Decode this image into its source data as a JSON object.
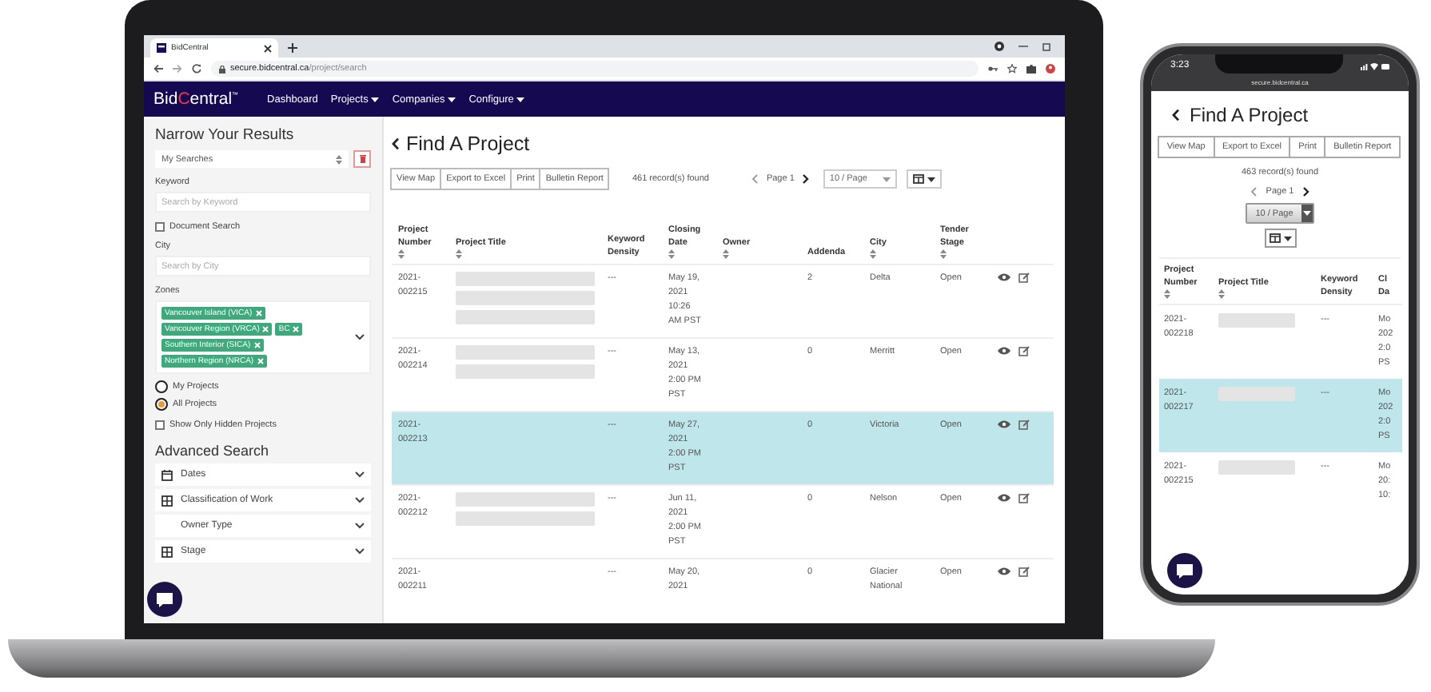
{
  "laptop": {
    "browser": {
      "tab": {
        "title": "BidCentral"
      },
      "url": {
        "host": "secure.bidcentral.ca",
        "path": "/project/search"
      }
    },
    "navbar": {
      "logo": [
        {
          "text": "Bid",
          "accent": false
        },
        {
          "text": "C",
          "accent": true
        },
        {
          "text": "entral",
          "accent": false
        }
      ],
      "trademark": "™",
      "items": [
        {
          "label": "Dashboard",
          "dropdown": false
        },
        {
          "label": "Projects",
          "dropdown": true
        },
        {
          "label": "Companies",
          "dropdown": true
        },
        {
          "label": "Configure",
          "dropdown": true
        }
      ]
    },
    "sidebar": {
      "title": "Narrow Your Results",
      "saved_searches": {
        "value": "My Searches"
      },
      "keyword": {
        "label": "Keyword",
        "placeholder": "Search by Keyword"
      },
      "document_search": {
        "label": "Document Search",
        "checked": false
      },
      "city": {
        "label": "City",
        "placeholder": "Search by City"
      },
      "zones": {
        "label": "Zones",
        "tags": [
          "Vancouver Island (VICA)",
          "Vancouver Region (VRCA)",
          "BC",
          "Southern Interior (SICA)",
          "Northern Region (NRCA)"
        ]
      },
      "scope": [
        {
          "label": "My Projects",
          "selected": false
        },
        {
          "label": "All Projects",
          "selected": true
        }
      ],
      "hidden_only": {
        "label": "Show Only Hidden Projects",
        "checked": false
      },
      "advanced_title": "Advanced Search",
      "advanced": [
        {
          "label": "Dates",
          "kind": "calendar"
        },
        {
          "label": "Classification of Work",
          "kind": "grid"
        },
        {
          "label": "Owner Type",
          "kind": "plain"
        },
        {
          "label": "Stage",
          "kind": "grid"
        }
      ]
    },
    "main": {
      "title": "Find A Project",
      "actions": [
        "View Map",
        "Export to Excel",
        "Print",
        "Bulletin Report"
      ],
      "records": "461 record(s) found",
      "page": "Page 1",
      "page_size": "10 / Page",
      "table": {
        "columns": [
          {
            "label": "Project Number",
            "sortable": true
          },
          {
            "label": "Project Title",
            "sortable": true
          },
          {
            "label": "Keyword Density",
            "sortable": false
          },
          {
            "label": "Closing Date",
            "sortable": true
          },
          {
            "label": "Owner",
            "sortable": true
          },
          {
            "label": "Addenda",
            "sortable": false
          },
          {
            "label": "City",
            "sortable": true
          },
          {
            "label": "Tender Stage",
            "sortable": true
          }
        ],
        "rows": [
          {
            "number": "2021-002215",
            "title_lines": [
              {
                "kind": "bar"
              },
              {
                "kind": "bar"
              },
              {
                "kind": "bar"
              }
            ],
            "density": "---",
            "closing": "May 19, 2021 10:26 AM PST",
            "addenda": "2",
            "city": "Delta",
            "stage": "Open",
            "selected": false
          },
          {
            "number": "2021-002214",
            "title_lines": [
              {
                "kind": "bar"
              },
              {
                "kind": "bar"
              }
            ],
            "density": "---",
            "closing": "May 13, 2021 2:00 PM PST",
            "addenda": "0",
            "city": "Merritt",
            "stage": "Open",
            "selected": false
          },
          {
            "number": "2021-002213",
            "title_lines": [],
            "density": "---",
            "closing": "May 27, 2021 2:00 PM PST",
            "addenda": "0",
            "city": "Victoria",
            "stage": "Open",
            "selected": true
          },
          {
            "number": "2021-002212",
            "title_lines": [
              {
                "kind": "bar"
              },
              {
                "kind": "bar"
              }
            ],
            "density": "---",
            "closing": "Jun 11, 2021 2:00 PM PST",
            "addenda": "0",
            "city": "Nelson",
            "stage": "Open",
            "selected": false
          },
          {
            "number": "2021-002211",
            "title_lines": [],
            "density": "---",
            "closing": "May 20, 2021",
            "addenda": "0",
            "city": "Glacier National",
            "stage": "Open",
            "selected": false
          }
        ]
      }
    }
  },
  "phone": {
    "time": "3:23",
    "url": "secure.bidcentral.ca",
    "title": "Find A Project",
    "actions": [
      "View Map",
      "Export to Excel",
      "Print",
      "Bulletin Report"
    ],
    "records": "463 record(s) found",
    "page": "Page 1",
    "page_size": "10 / Page",
    "table": {
      "columns": [
        {
          "label": "Project Number",
          "sortable": true
        },
        {
          "label": "Project Title",
          "sortable": true
        },
        {
          "label": "Keyword Density",
          "sortable": false
        },
        {
          "label": "Cl Da",
          "sortable": false
        }
      ],
      "rows": [
        {
          "number": "2021-002218",
          "title_lines": [
            {
              "kind": "bar"
            }
          ],
          "density": "---",
          "column_4": "Mo 202 2:0 PS",
          "selected": false
        },
        {
          "number": "2021-002217",
          "title_lines": [
            {
              "kind": "bar"
            }
          ],
          "density": "---",
          "column_4": "Mo 202 2:0 PS",
          "selected": true
        },
        {
          "number": "2021-002215",
          "title_lines": [
            {
              "kind": "bar"
            }
          ],
          "density": "---",
          "column_4": "Mo 20: 10:",
          "selected": false
        }
      ]
    }
  }
}
